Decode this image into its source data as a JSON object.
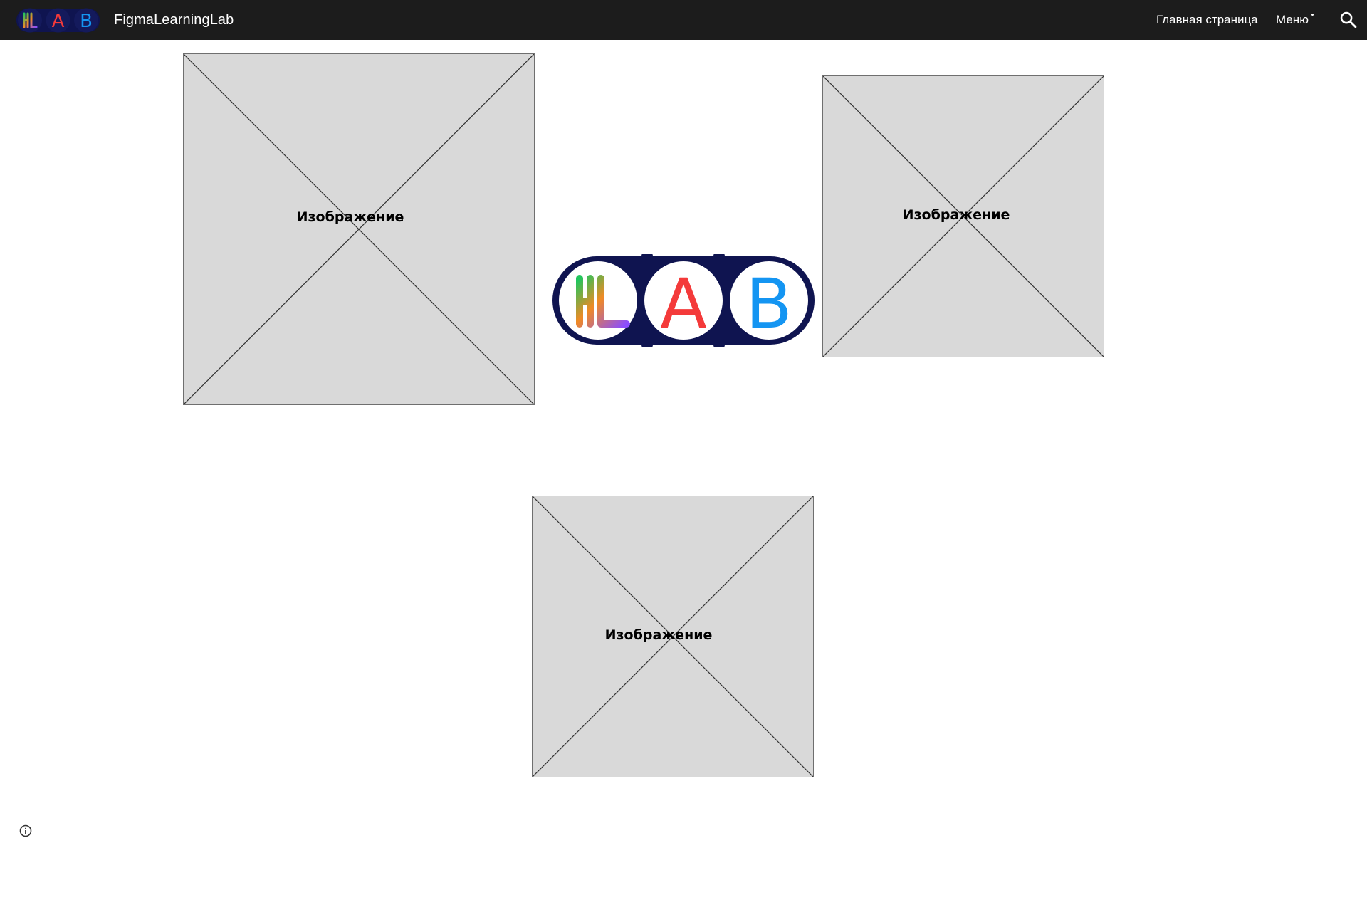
{
  "header": {
    "site_title": "FigmaLearningLab",
    "logo_letters": [
      "A",
      "B"
    ],
    "nav": {
      "home_label": "Главная страница",
      "menu_label": "Меню"
    },
    "search_icon": "search-icon"
  },
  "main": {
    "image_placeholders": [
      {
        "label": "Изображение"
      },
      {
        "label": "Изображение"
      },
      {
        "label": "Изображение"
      }
    ],
    "logo_letters": [
      "A",
      "B"
    ]
  },
  "footer": {
    "info_icon": "info-icon"
  },
  "colors": {
    "topbar_bg": "#1c1c1c",
    "placeholder_bg": "#d9d9d9",
    "logo_navy": "#0f1450",
    "logo_red": "#f43a3a",
    "logo_blue": "#1495f2",
    "logo_green": "#21c55d",
    "logo_purple": "#8b4dff"
  }
}
